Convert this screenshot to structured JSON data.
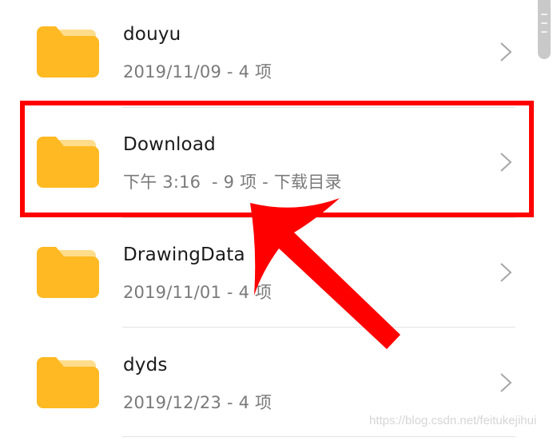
{
  "folders": [
    {
      "name": "douyu",
      "meta": "2019/11/09 - 4 项"
    },
    {
      "name": "Download",
      "meta": "下午 3:16  - 9 项 - 下载目录"
    },
    {
      "name": "DrawingData",
      "meta": "2019/11/01 - 4 项"
    },
    {
      "name": "dyds",
      "meta": "2019/12/23 - 4 项"
    }
  ],
  "icons": {
    "folder": "folder-icon",
    "chevron": "chevron-right-icon"
  },
  "annotation": {
    "highlighted_item": "Download",
    "color": "#ff0000"
  },
  "colors": {
    "folder_front": "#ffb922",
    "folder_back": "#ffdd8c",
    "title": "#1a1a1a",
    "subtitle": "#7a7a7a"
  },
  "watermark": "https://blog.csdn.net/feitukejihui"
}
